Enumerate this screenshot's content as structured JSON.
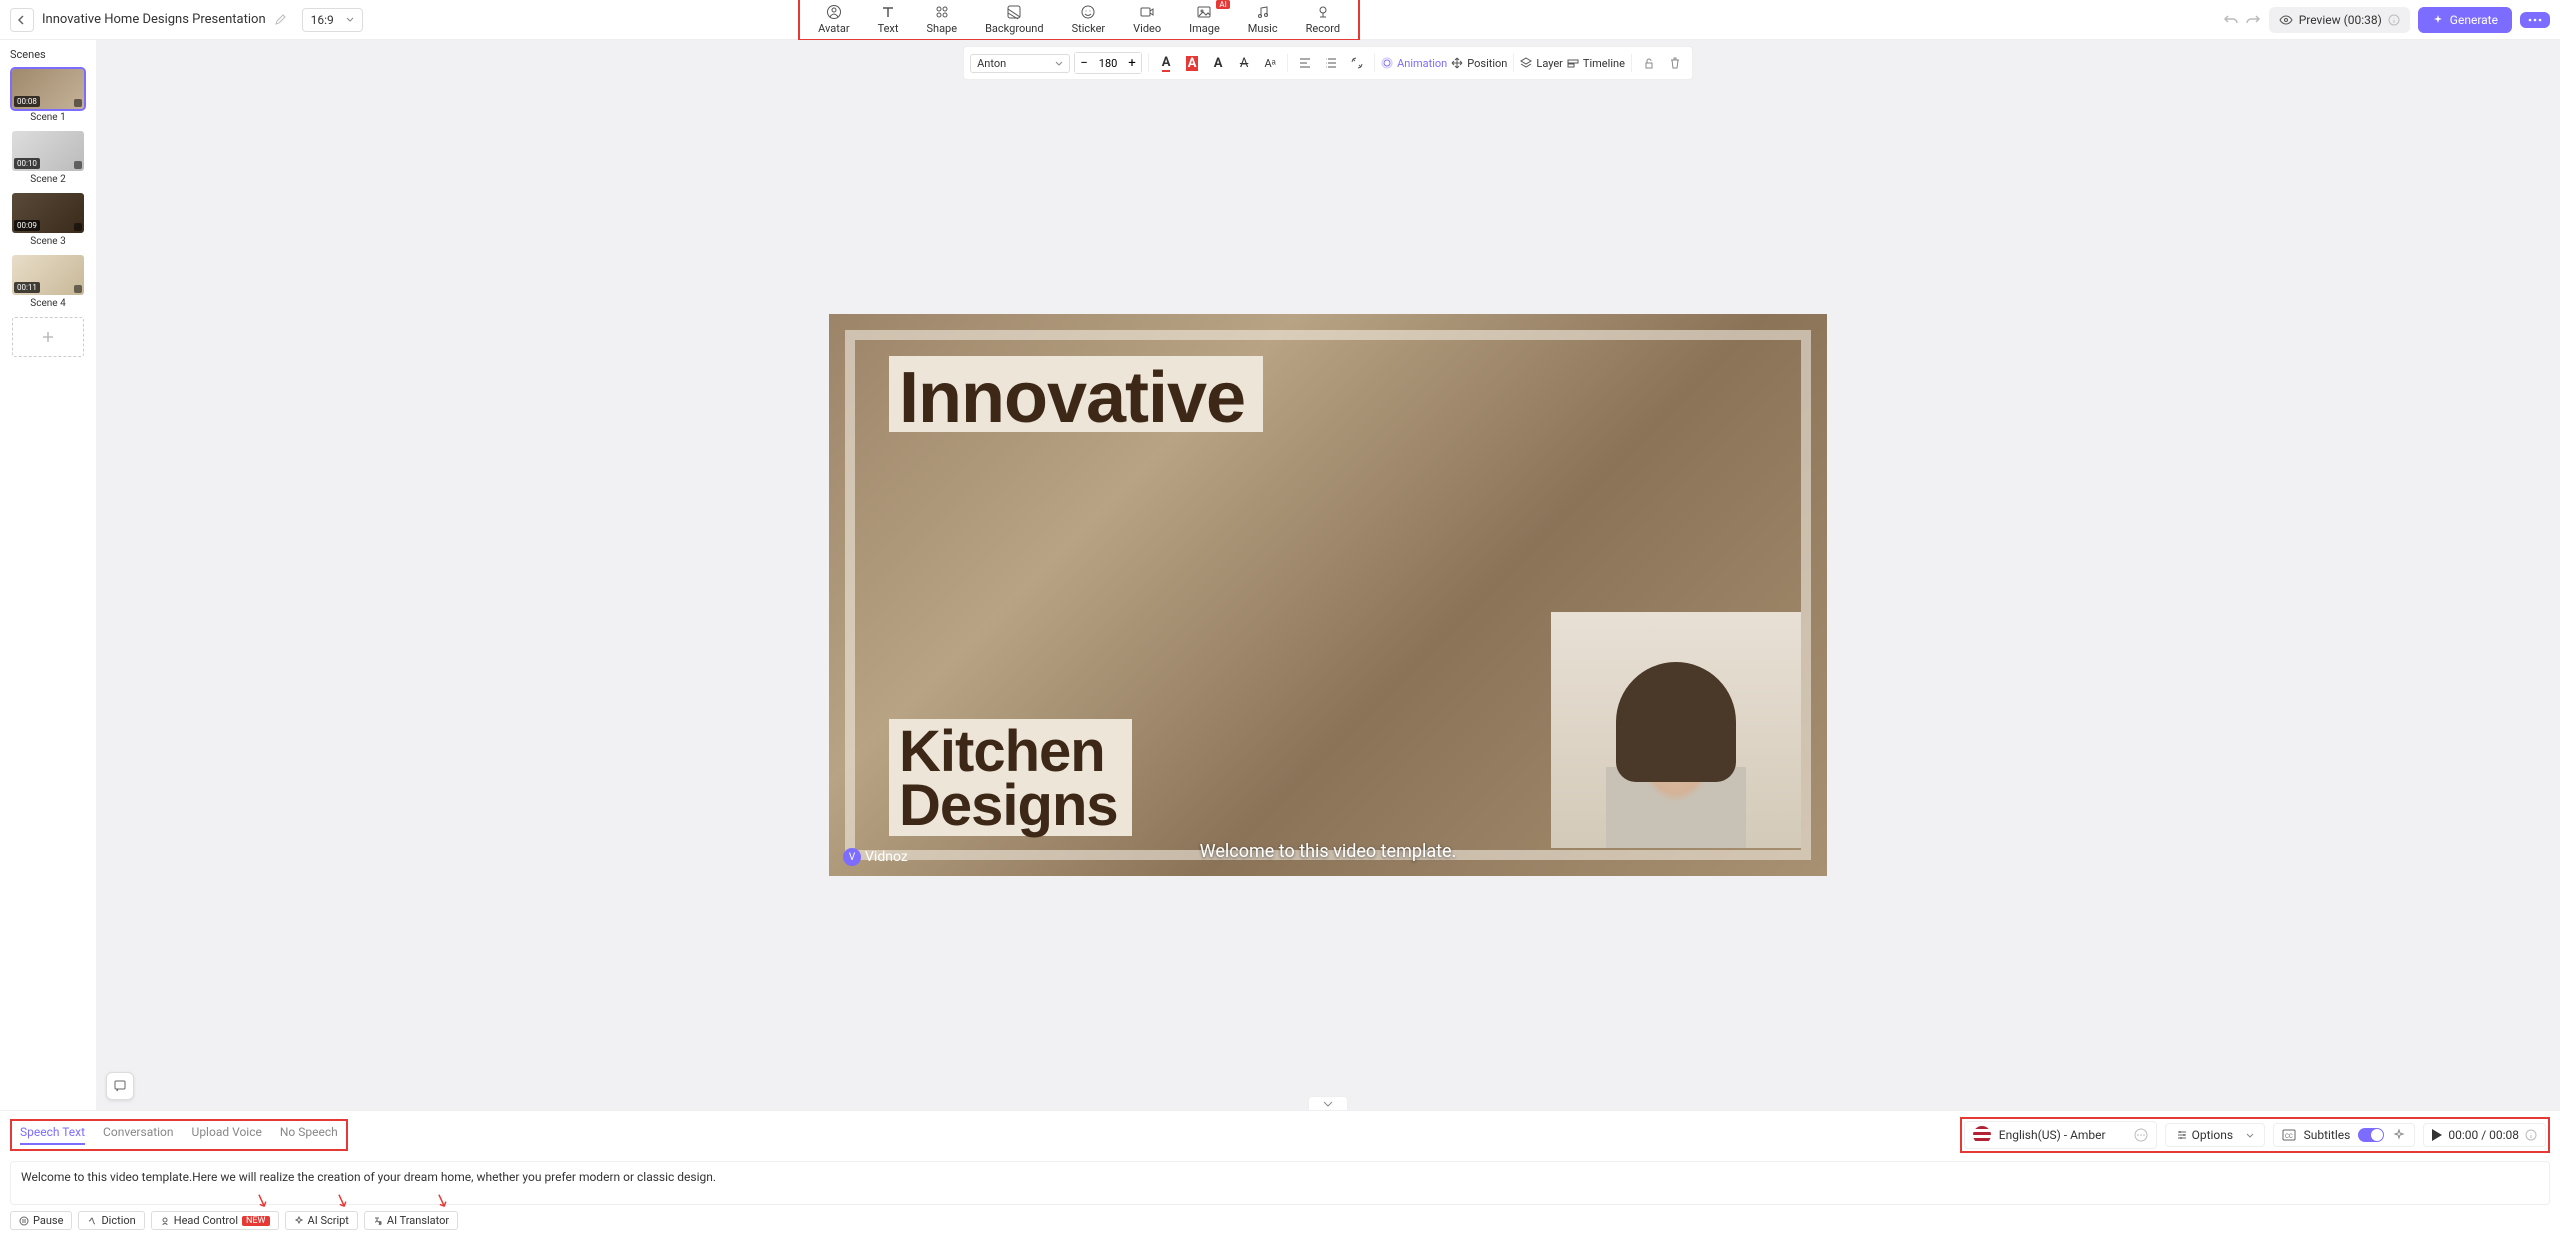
{
  "header": {
    "title": "Innovative Home Designs Presentation",
    "ratio": "16:9",
    "preview_label": "Preview (00:38)",
    "generate_label": "Generate"
  },
  "top_tools": [
    {
      "label": "Avatar"
    },
    {
      "label": "Text"
    },
    {
      "label": "Shape"
    },
    {
      "label": "Background"
    },
    {
      "label": "Sticker"
    },
    {
      "label": "Video"
    },
    {
      "label": "Image",
      "ai": true
    },
    {
      "label": "Music"
    },
    {
      "label": "Record"
    }
  ],
  "toolbar2": {
    "font": "Anton",
    "size": "180",
    "animation": "Animation",
    "position": "Position",
    "layer": "Layer",
    "timeline": "Timeline"
  },
  "scenes_title": "Scenes",
  "scenes": [
    {
      "label": "Scene 1",
      "dur": "00:08",
      "active": true
    },
    {
      "label": "Scene 2",
      "dur": "00:10"
    },
    {
      "label": "Scene 3",
      "dur": "00:09"
    },
    {
      "label": "Scene 4",
      "dur": "00:11"
    }
  ],
  "canvas": {
    "title1": "Innovative",
    "title2a": "Kitchen",
    "title2b": "Designs",
    "caption": "Welcome to this video template.",
    "logo": "Vidnoz"
  },
  "tabs": [
    {
      "label": "Speech Text",
      "active": true
    },
    {
      "label": "Conversation"
    },
    {
      "label": "Upload Voice"
    },
    {
      "label": "No Speech"
    }
  ],
  "voice": "English(US) - Amber",
  "options_label": "Options",
  "subtitles_label": "Subtitles",
  "time": "00:00 / 00:08",
  "speech_text": "Welcome to this video template.Here we will realize the creation of your dream home, whether you prefer modern or classic design.",
  "chips": {
    "pause": "Pause",
    "diction": "Diction",
    "head_control": "Head Control",
    "new": "NEW",
    "ai_script": "AI Script",
    "ai_translator": "AI Translator"
  }
}
